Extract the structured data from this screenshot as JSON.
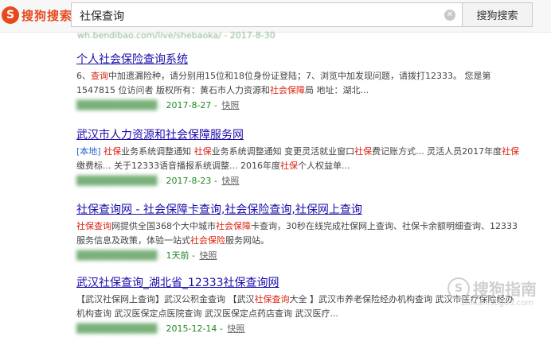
{
  "search": {
    "logo_text": "搜狗搜索",
    "query": "社保查询",
    "button_label": "搜狗搜索"
  },
  "top_url": "wh.bendibao.com/live/shebaoka/ - 2017-8-30",
  "results": [
    {
      "title": "个人社会保险查询系统",
      "desc": [
        {
          "t": "6、"
        },
        {
          "t": "查询",
          "hl": true
        },
        {
          "t": "中加遗漏险种，请分别用15位和18位身份证登陆；7、浏览中加发现问题，请拨打12333。 您是第 1547815 位访问者 版权所有：黄石市人力资源和"
        },
        {
          "t": "社会保障",
          "hl": true
        },
        {
          "t": "局 地址：湖北..."
        }
      ],
      "date": "2017-8-27",
      "snapshot": "快照"
    },
    {
      "title": "武汉市人力资源和社会保障服务网",
      "desc": [
        {
          "t": "[本地]",
          "local": true
        },
        {
          "t": " "
        },
        {
          "t": "社保",
          "hl": true
        },
        {
          "t": "业务系统调整通知 "
        },
        {
          "t": "社保",
          "hl": true
        },
        {
          "t": "业务系统调整通知 变更灵活就业窗口"
        },
        {
          "t": "社保",
          "hl": true
        },
        {
          "t": "费记账方式... 灵活人员2017年度"
        },
        {
          "t": "社保",
          "hl": true
        },
        {
          "t": "缴费标... 关于12333语音播报系统调整... 2016年度"
        },
        {
          "t": "社保",
          "hl": true
        },
        {
          "t": "个人权益单..."
        }
      ],
      "date": "2017-8-23",
      "snapshot": "快照"
    },
    {
      "title": "社保查询网 - 社会保障卡查询,社会保险查询,社保网上查询",
      "desc": [
        {
          "t": "社保查询",
          "hl": true
        },
        {
          "t": "网提供全国368个大中城市"
        },
        {
          "t": "社会保障",
          "hl": true
        },
        {
          "t": "卡查询，30秒在线完成社保网上查询、社保卡余额明细查询、12333服务信息及政策，体验一站式"
        },
        {
          "t": "社会保险",
          "hl": true
        },
        {
          "t": "服务网站。"
        }
      ],
      "date": "1天前",
      "snapshot": "快照"
    },
    {
      "title": "武汉社保查询_湖北省_12333社保查询网",
      "desc": [
        {
          "t": "【武汉社保网上查询】武汉公积金查询 【武汉"
        },
        {
          "t": "社保查询",
          "hl": true
        },
        {
          "t": "大全 】武汉市养老保险经办机构查询 武汉市医疗保险经办机构查询 武汉医保定点医院查询 武汉医保定点药店查询 武汉医疗..."
        }
      ],
      "date": "2015-12-14",
      "snapshot": "快照"
    }
  ],
  "watermark": {
    "text": "搜狗指南",
    "url": "zhinan.sogou.com"
  }
}
